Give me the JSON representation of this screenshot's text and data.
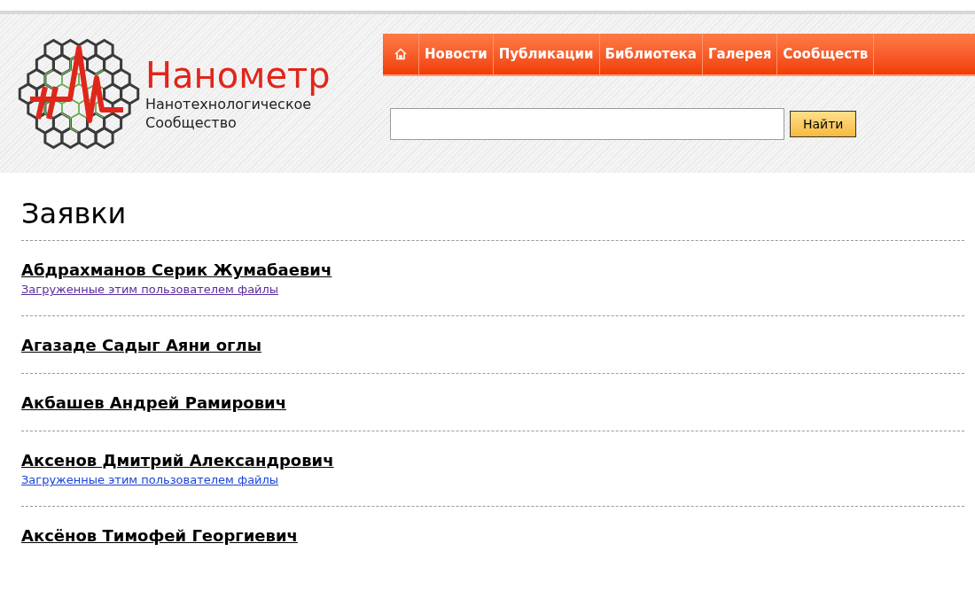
{
  "logo": {
    "title": "Нанометр",
    "subtitle_lines": [
      "Нанотехнологическое",
      "Сообщество"
    ]
  },
  "nav": {
    "items": [
      {
        "kind": "home"
      },
      {
        "kind": "text",
        "label": "Новости"
      },
      {
        "kind": "text",
        "label": "Публикации"
      },
      {
        "kind": "text",
        "label": "Библиотека"
      },
      {
        "kind": "text",
        "label": "Галерея"
      },
      {
        "kind": "text",
        "label": "Сообществ"
      }
    ]
  },
  "search": {
    "button": "Найти"
  },
  "page_title": "Заявки",
  "entries": [
    {
      "name": "Абдрахманов Серик Жумабаевич",
      "link": {
        "text": "Загруженные этим пользователем файлы",
        "visited": true
      }
    },
    {
      "name": "Агазаде Садыг Аяни оглы"
    },
    {
      "name": "Акбашев Андрей Рамирович"
    },
    {
      "name": "Аксенов Дмитрий Александрович",
      "link": {
        "text": "Загруженные этим пользователем файлы",
        "visited": false
      }
    },
    {
      "name": "Аксёнов Тимофей Георгиевич"
    }
  ]
}
